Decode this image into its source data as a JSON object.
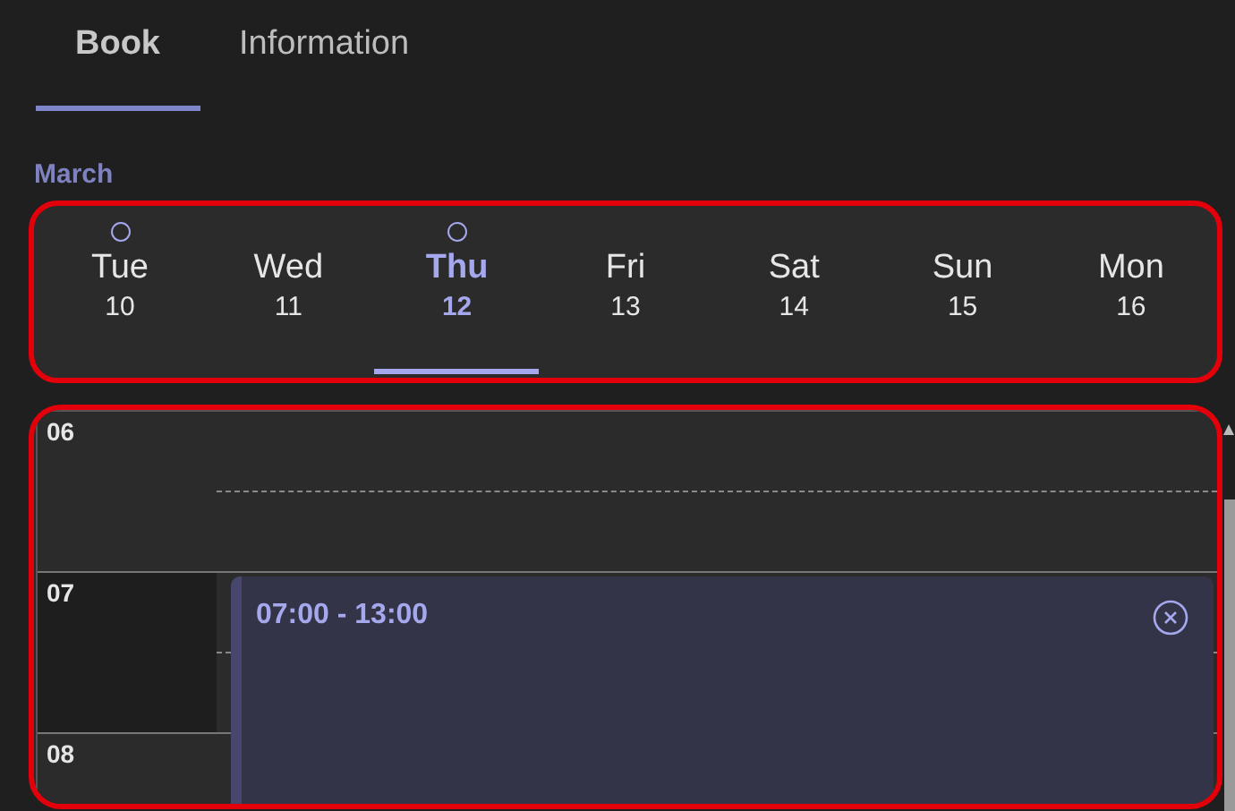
{
  "tabs": [
    {
      "label": "Book",
      "selected": true
    },
    {
      "label": "Information",
      "selected": false
    }
  ],
  "month": "March",
  "days": [
    {
      "weekday": "Tue",
      "date": "10",
      "selected": false,
      "has_booking": true
    },
    {
      "weekday": "Wed",
      "date": "11",
      "selected": false,
      "has_booking": false
    },
    {
      "weekday": "Thu",
      "date": "12",
      "selected": true,
      "has_booking": true
    },
    {
      "weekday": "Fri",
      "date": "13",
      "selected": false,
      "has_booking": false
    },
    {
      "weekday": "Sat",
      "date": "14",
      "selected": false,
      "has_booking": false
    },
    {
      "weekday": "Sun",
      "date": "15",
      "selected": false,
      "has_booking": false
    },
    {
      "weekday": "Mon",
      "date": "16",
      "selected": false,
      "has_booking": false
    }
  ],
  "hours": [
    {
      "label": "06",
      "highlighted": false
    },
    {
      "label": "07",
      "highlighted": true,
      "booking": {
        "time": "07:00 - 13:00"
      }
    },
    {
      "label": "08",
      "highlighted": false
    }
  ]
}
